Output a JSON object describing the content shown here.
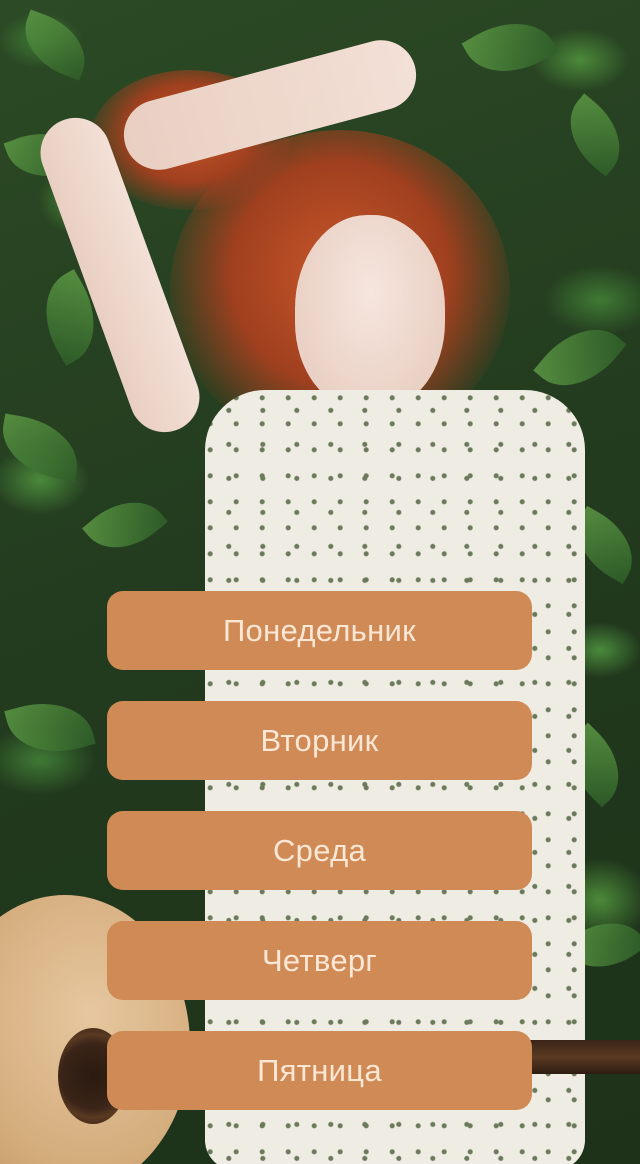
{
  "background": {
    "image": "woman-lying-on-leaves-photo"
  },
  "menu": {
    "accent_color": "#d08a55",
    "text_color": "#fbe7d6",
    "days": [
      {
        "label": "Понедельник"
      },
      {
        "label": "Вторник"
      },
      {
        "label": "Среда"
      },
      {
        "label": "Четверг"
      },
      {
        "label": "Пятница"
      }
    ]
  }
}
